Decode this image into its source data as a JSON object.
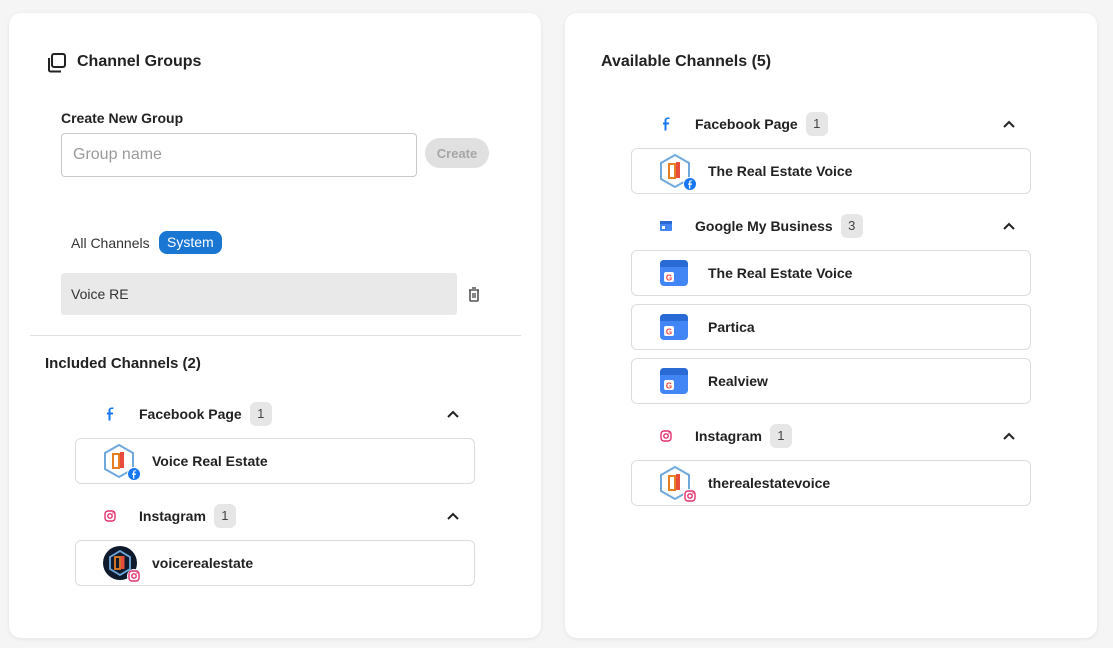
{
  "left": {
    "title": "Channel Groups",
    "title_icon": "copy-stack-icon",
    "create_label": "Create New Group",
    "group_name_placeholder": "Group name",
    "create_button": "Create",
    "filters": {
      "all": "All Channels",
      "system": "System"
    },
    "groups": [
      {
        "name": "Voice RE"
      }
    ],
    "included_title": "Included Channels (2)",
    "included": [
      {
        "platform": "Facebook Page",
        "icon": "facebook-icon",
        "count": "1",
        "channels": [
          {
            "name": "Voice Real Estate",
            "avatar": "voice-logo",
            "badge": "facebook"
          }
        ]
      },
      {
        "platform": "Instagram",
        "icon": "instagram-icon",
        "count": "1",
        "channels": [
          {
            "name": "voicerealestate",
            "avatar": "voice-logo-dark",
            "badge": "instagram"
          }
        ]
      }
    ]
  },
  "right": {
    "title": "Available Channels (5)",
    "sections": [
      {
        "platform": "Facebook Page",
        "icon": "facebook-icon",
        "count": "1",
        "channels": [
          {
            "name": "The Real Estate Voice",
            "avatar": "voice-logo",
            "badge": "facebook"
          }
        ]
      },
      {
        "platform": "Google My Business",
        "icon": "google-business-icon",
        "count": "3",
        "channels": [
          {
            "name": "The Real Estate Voice",
            "avatar": "gmb-store"
          },
          {
            "name": "Partica",
            "avatar": "gmb-store"
          },
          {
            "name": "Realview",
            "avatar": "gmb-store"
          }
        ]
      },
      {
        "platform": "Instagram",
        "icon": "instagram-icon",
        "count": "1",
        "channels": [
          {
            "name": "therealestatevoice",
            "avatar": "voice-logo",
            "badge": "instagram"
          }
        ]
      }
    ]
  },
  "colors": {
    "accent": "#1976d2",
    "facebook": "#1877f2",
    "instagram": "#e1306c",
    "gmb": "#4285f4"
  }
}
